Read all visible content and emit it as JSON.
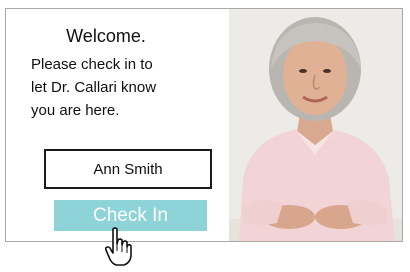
{
  "welcome": {
    "title": "Welcome.",
    "message_line1": "Please check in to",
    "message_line2": "let Dr. Callari know",
    "message_line3": "you are here."
  },
  "patient": {
    "name": "Ann Smith"
  },
  "checkin": {
    "button_label": "Check In"
  },
  "icons": {
    "cursor": "hand-pointer-icon"
  },
  "colors": {
    "button_bg": "#8ed3d8",
    "button_text": "#ffffff",
    "border": "#a9a9a9"
  }
}
